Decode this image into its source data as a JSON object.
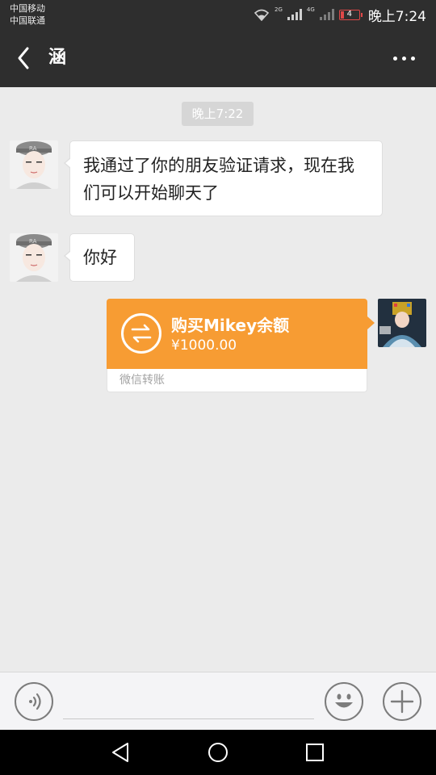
{
  "status_bar": {
    "carrier_1": "中国移动",
    "carrier_2": "中国联通",
    "net_1": "2G",
    "net_2": "4G",
    "battery_level": "4",
    "time": "晚上7:24"
  },
  "header": {
    "title": "涵",
    "back_icon": "chevron-left-icon",
    "more_icon": "more-dots-icon",
    "background": "#2e2e2e"
  },
  "chat": {
    "timestamp": "晚上7:22",
    "messages": [
      {
        "side": "left",
        "text": "我通过了你的朋友验证请求，现在我们可以开始聊天了"
      },
      {
        "side": "left",
        "text": "你好"
      }
    ],
    "transfer": {
      "title": "购买Mikey余额",
      "amount": "¥1000.00",
      "label": "微信转账",
      "icon": "transfer-arrows-icon",
      "color": "#f79c33"
    }
  },
  "input_bar": {
    "voice_icon": "voice-icon",
    "emoji_icon": "emoji-icon",
    "plus_icon": "plus-icon",
    "placeholder": ""
  },
  "nav_bar": {
    "back_icon": "triangle-back-icon",
    "home_icon": "circle-home-icon",
    "recent_icon": "square-recent-icon"
  }
}
